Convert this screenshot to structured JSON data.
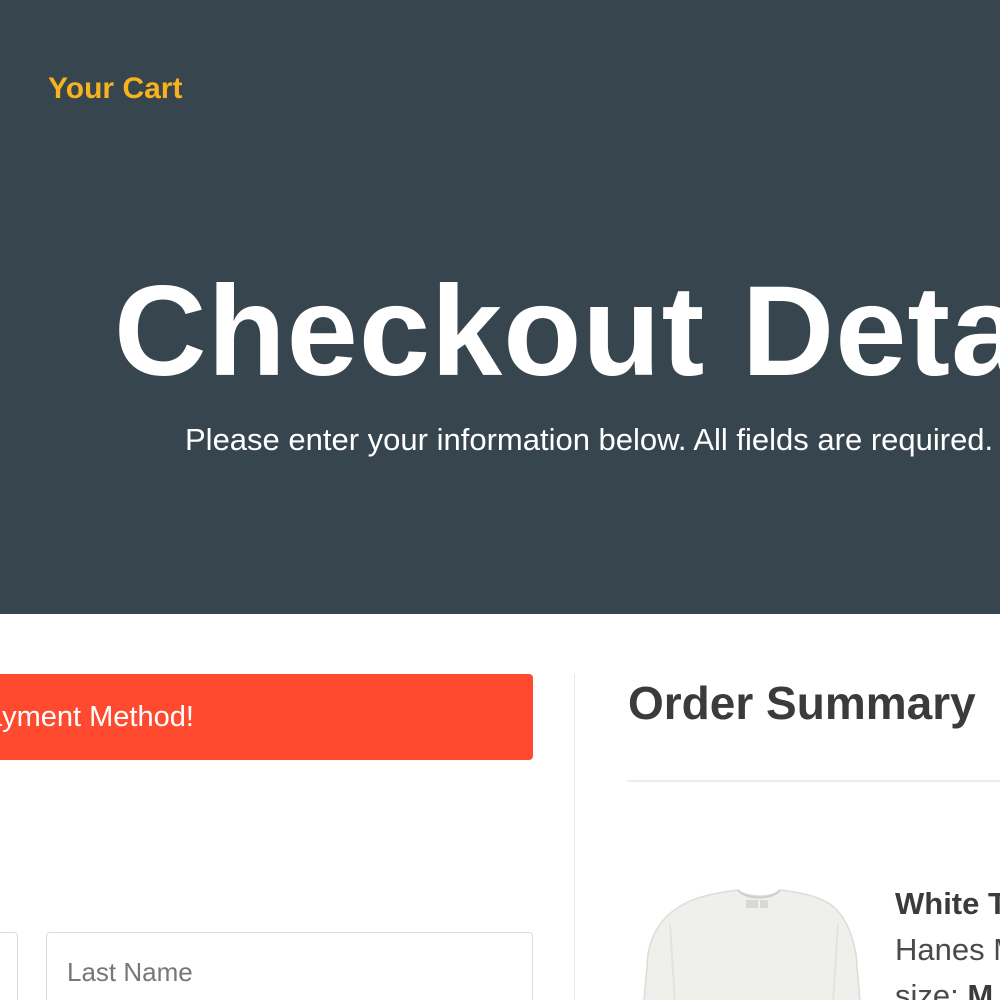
{
  "header": {
    "cart_link": "Your Cart",
    "title": "Checkout Details",
    "subtitle": "Please enter your information below. All fields are required."
  },
  "alert": {
    "message": "Please add your Payment Method!"
  },
  "form": {
    "last_name_placeholder": "Last Name"
  },
  "summary": {
    "title": "Order Summary",
    "items": [
      {
        "name": "White T-Shirt",
        "brand": "Hanes Men's",
        "size_label": "size:",
        "size_value": "M",
        "image_icon": "t-shirt-image"
      }
    ]
  },
  "colors": {
    "hero_background": "#36454e",
    "accent": "#f7b21d",
    "alert": "#ff4a2f"
  }
}
